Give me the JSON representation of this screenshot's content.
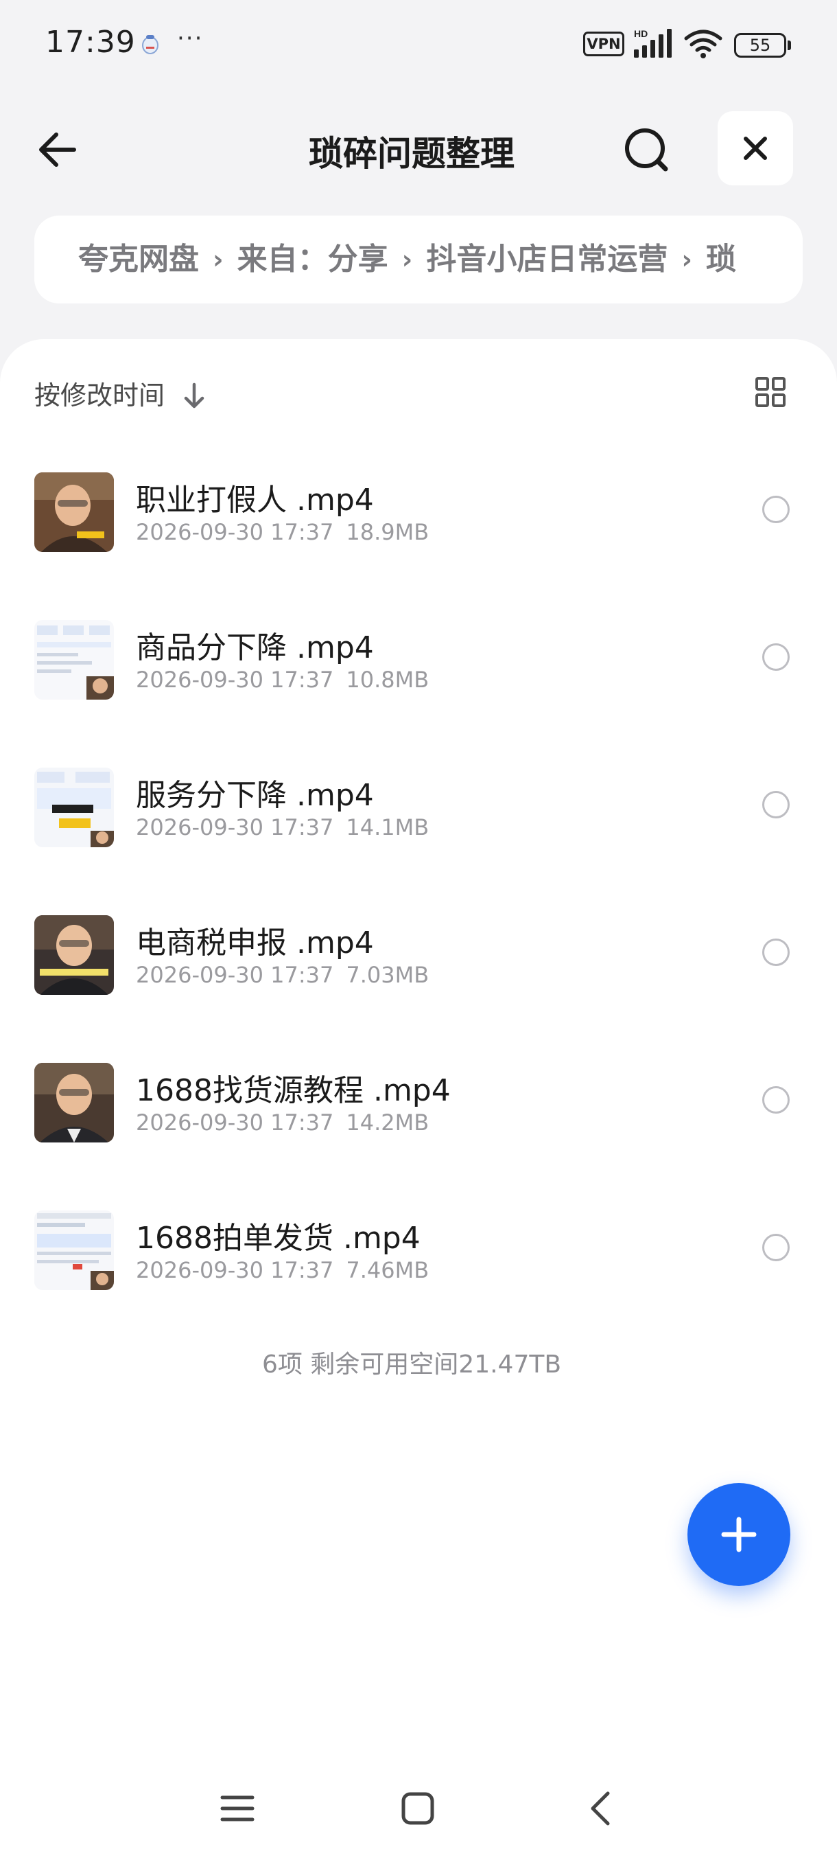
{
  "status_bar": {
    "time": "17:39",
    "more": "···",
    "vpn": "VPN",
    "battery": "55",
    "icons": [
      "notification-app-icon",
      "signal-hd-icon",
      "wifi-icon",
      "battery-icon"
    ]
  },
  "header": {
    "title": "琐碎问题整理",
    "icons": [
      "back-arrow-icon",
      "search-icon",
      "close-icon"
    ]
  },
  "breadcrumb": {
    "items": [
      "夸克网盘",
      "来自：分享",
      "抖音小店日常运营",
      "琐"
    ],
    "separator": "›"
  },
  "sort": {
    "label": "按修改时间",
    "icons": [
      "sort-down-arrow-icon",
      "grid-view-icon"
    ]
  },
  "files": [
    {
      "name": "职业打假人 .mp4",
      "date": "2026-09-30 17:37",
      "size": "18.9MB",
      "thumb": "person"
    },
    {
      "name": "商品分下降 .mp4",
      "date": "2026-09-30 17:37",
      "size": "10.8MB",
      "thumb": "screen"
    },
    {
      "name": "服务分下降 .mp4",
      "date": "2026-09-30 17:37",
      "size": "14.1MB",
      "thumb": "screen"
    },
    {
      "name": "电商税申报 .mp4",
      "date": "2026-09-30 17:37",
      "size": "7.03MB",
      "thumb": "person"
    },
    {
      "name": "1688找货源教程 .mp4",
      "date": "2026-09-30 17:37",
      "size": "14.2MB",
      "thumb": "person"
    },
    {
      "name": "1688拍单发货 .mp4",
      "date": "2026-09-30 17:37",
      "size": "7.46MB",
      "thumb": "screen"
    }
  ],
  "summary": "6项 剩余可用空间21.47TB",
  "fab": {
    "icon": "plus-icon"
  },
  "nav": {
    "icons": [
      "menu-icon",
      "home-square-icon",
      "back-chevron-icon"
    ]
  },
  "colors": {
    "accent": "#1f6bf5",
    "background": "#f3f3f5",
    "text": "#1b1b1b",
    "muted": "#9a9a9e"
  }
}
